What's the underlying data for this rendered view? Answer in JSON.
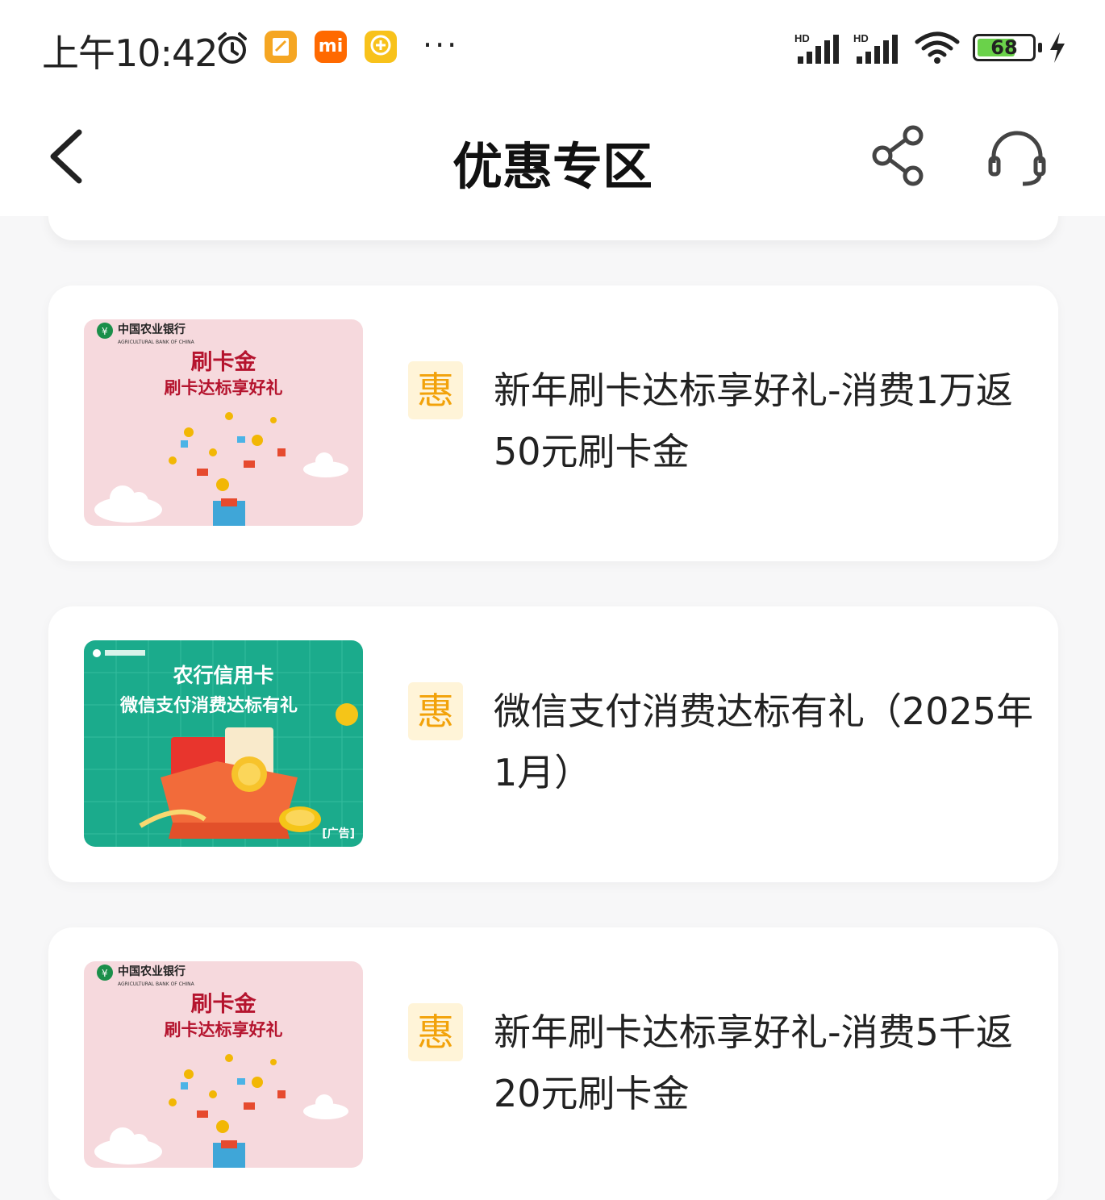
{
  "status_bar": {
    "time": "上午10:42",
    "app_badge_b": "mi",
    "battery_level": "68",
    "more": "···"
  },
  "nav": {
    "title": "优惠专区"
  },
  "colors": {
    "accent_badge_bg": "#fff4d8",
    "accent_badge_fg": "#f2a20a",
    "card_bg": "#ffffff",
    "page_bg": "#f7f7f8"
  },
  "promotions": [
    {
      "badge": "惠",
      "title": "新年刷卡达标享好礼-消费1万返50元刷卡金",
      "image": {
        "bank": "中国农业银行",
        "bank_en": "AGRICULTURAL BANK OF CHINA",
        "headline": "刷卡金",
        "subline": "刷卡达标享好礼"
      }
    },
    {
      "badge": "惠",
      "title": "微信支付消费达标有礼（2025年1月）",
      "image": {
        "headline": "农行信用卡",
        "subline": "微信支付消费达标有礼",
        "tag": "[广告]"
      }
    },
    {
      "badge": "惠",
      "title": "新年刷卡达标享好礼-消费5千返20元刷卡金",
      "image": {
        "bank": "中国农业银行",
        "bank_en": "AGRICULTURAL BANK OF CHINA",
        "headline": "刷卡金",
        "subline": "刷卡达标享好礼"
      }
    }
  ]
}
